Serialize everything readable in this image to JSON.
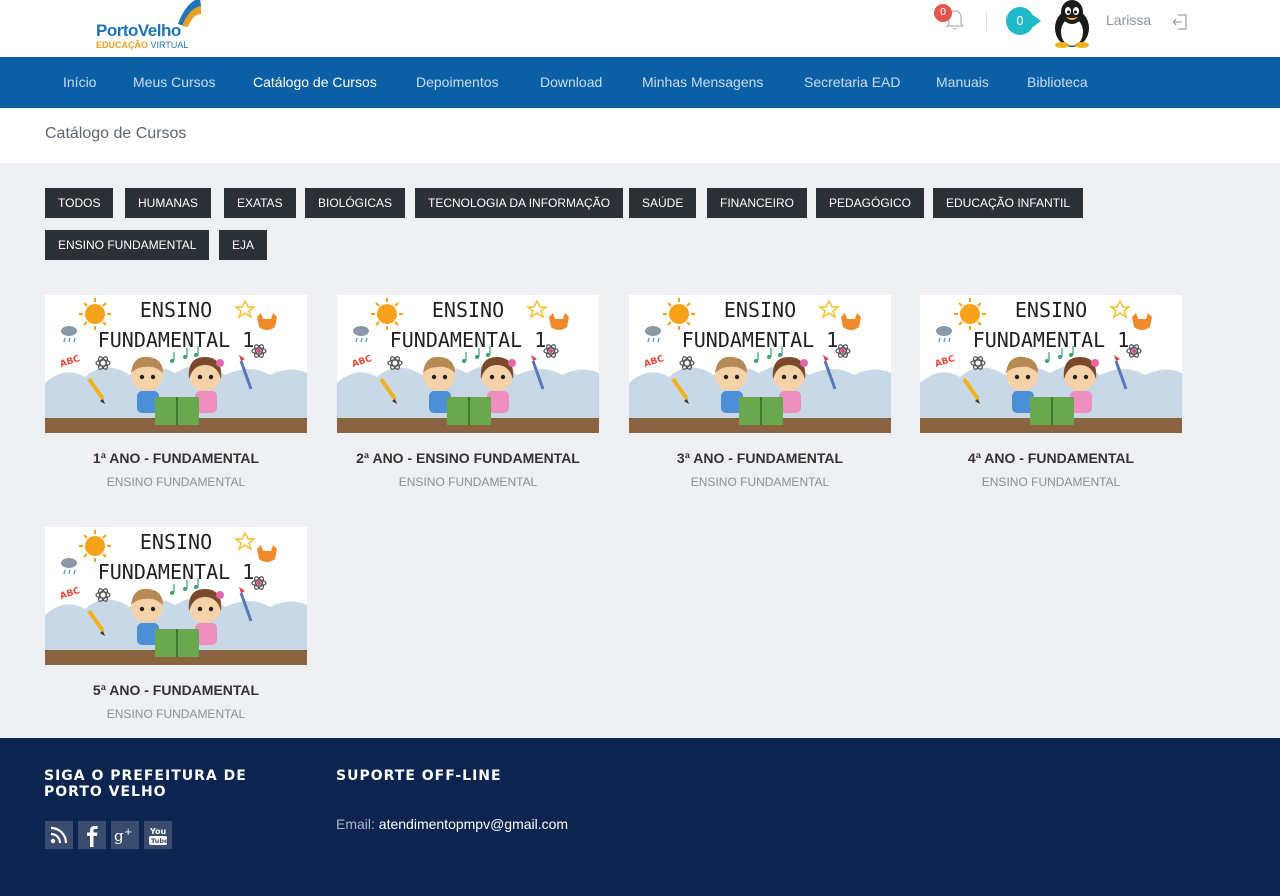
{
  "header": {
    "logo_brand": "PortoVelho",
    "logo_sub_a": "EDUCAÇÃO",
    "logo_sub_b": "VIRTUAL",
    "notifications_count": "0",
    "messages_count": "0",
    "username": "Larissa"
  },
  "nav": {
    "items": [
      "Início",
      "Meus Cursos",
      "Catálogo de Cursos",
      "Depoimentos",
      "Download",
      "Minhas Mensagens",
      "Secretaria EAD",
      "Manuais",
      "Biblioteca"
    ],
    "active": "Catálogo de Cursos"
  },
  "breadcrumb": "Catálogo de Cursos",
  "filters": [
    "TODOS",
    "HUMANAS",
    "EXATAS",
    "BIOLÓGICAS",
    "TECNOLOGIA DA INFORMAÇÃO",
    "SAÚDE",
    "FINANCEIRO",
    "PEDAGÓGICO",
    "EDUCAÇÃO INFANTIL",
    "ENSINO FUNDAMENTAL",
    "EJA"
  ],
  "thumb_text": {
    "line1": "ENSINO",
    "line2": "FUNDAMENTAL 1",
    "abc": "ABC"
  },
  "courses": [
    {
      "title": "1ª ANO - FUNDAMENTAL",
      "category": "ENSINO FUNDAMENTAL"
    },
    {
      "title": "2ª ANO - ENSINO FUNDAMENTAL",
      "category": "ENSINO FUNDAMENTAL"
    },
    {
      "title": "3ª ANO - FUNDAMENTAL",
      "category": "ENSINO FUNDAMENTAL"
    },
    {
      "title": "4ª ANO - FUNDAMENTAL",
      "category": "ENSINO FUNDAMENTAL"
    },
    {
      "title": "5ª ANO - FUNDAMENTAL",
      "category": "ENSINO FUNDAMENTAL"
    }
  ],
  "footer": {
    "follow_heading": "SIGA O PREFEITURA DE PORTO VELHO",
    "support_heading": "SUPORTE OFF-LINE",
    "email_label": "Email:",
    "email_address": "atendimentopmpv@gmail.com",
    "social_icons": [
      "rss-icon",
      "facebook-icon",
      "google-plus-icon",
      "youtube-icon"
    ]
  },
  "colors": {
    "nav_bg": "#0b5fa5",
    "footer_bg": "#0b2450",
    "filter_bg": "#2b2f36",
    "page_bg": "#eef0f4",
    "badge_red": "#e2574c",
    "badge_teal": "#1fb9c9"
  }
}
